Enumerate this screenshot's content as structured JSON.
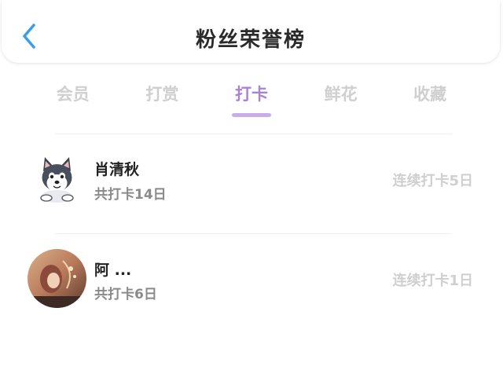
{
  "header": {
    "title": "粉丝荣誉榜",
    "back_icon": "chevron-left-icon",
    "accent": "#3a9ee8"
  },
  "tabs": [
    {
      "label": "会员",
      "active": false
    },
    {
      "label": "打赏",
      "active": false
    },
    {
      "label": "打卡",
      "active": true
    },
    {
      "label": "鲜花",
      "active": false
    },
    {
      "label": "收藏",
      "active": false
    }
  ],
  "active_color": "#a982d8",
  "fans": [
    {
      "name": "肖清秋",
      "total": "共打卡14日",
      "streak": "连续打卡5日",
      "avatar": "husky-avatar"
    },
    {
      "name": "阿 ...",
      "total": "共打卡6日",
      "streak": "连续打卡1日",
      "avatar": "anime-avatar"
    }
  ]
}
